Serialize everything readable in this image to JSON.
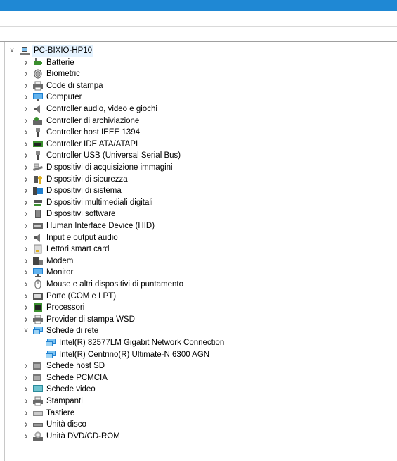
{
  "tree": {
    "root": {
      "label": "PC-BIXIO-HP10",
      "icon": "computer-icon"
    },
    "categories": [
      {
        "label": "Batterie",
        "icon": "battery-icon"
      },
      {
        "label": "Biometric",
        "icon": "fingerprint-icon"
      },
      {
        "label": "Code di stampa",
        "icon": "print-queue-icon"
      },
      {
        "label": "Computer",
        "icon": "monitor-icon"
      },
      {
        "label": "Controller audio, video e giochi",
        "icon": "speaker-icon"
      },
      {
        "label": "Controller di archiviazione",
        "icon": "storage-controller-icon"
      },
      {
        "label": "Controller host IEEE 1394",
        "icon": "firewire-icon"
      },
      {
        "label": "Controller IDE ATA/ATAPI",
        "icon": "ide-controller-icon"
      },
      {
        "label": "Controller USB (Universal Serial Bus)",
        "icon": "usb-icon"
      },
      {
        "label": "Dispositivi di acquisizione immagini",
        "icon": "scanner-icon"
      },
      {
        "label": "Dispositivi di sicurezza",
        "icon": "security-key-icon"
      },
      {
        "label": "Dispositivi di sistema",
        "icon": "system-device-icon"
      },
      {
        "label": "Dispositivi multimediali digitali",
        "icon": "media-device-icon"
      },
      {
        "label": "Dispositivi software",
        "icon": "software-device-icon"
      },
      {
        "label": "Human Interface Device (HID)",
        "icon": "hid-icon"
      },
      {
        "label": "Input e output audio",
        "icon": "speaker-icon"
      },
      {
        "label": "Lettori smart card",
        "icon": "smart-card-icon"
      },
      {
        "label": "Modem",
        "icon": "modem-icon"
      },
      {
        "label": "Monitor",
        "icon": "monitor-icon"
      },
      {
        "label": "Mouse e altri dispositivi di puntamento",
        "icon": "mouse-icon"
      },
      {
        "label": "Porte (COM e LPT)",
        "icon": "port-icon"
      },
      {
        "label": "Processori",
        "icon": "processor-icon"
      },
      {
        "label": "Provider di stampa WSD",
        "icon": "printer-icon"
      },
      {
        "label": "Schede di rete",
        "icon": "network-adapter-icon",
        "expanded": true,
        "children": [
          {
            "label": "Intel(R) 82577LM Gigabit Network Connection",
            "icon": "network-adapter-icon"
          },
          {
            "label": "Intel(R) Centrino(R) Ultimate-N 6300 AGN",
            "icon": "network-adapter-icon"
          }
        ]
      },
      {
        "label": "Schede host SD",
        "icon": "sd-host-icon"
      },
      {
        "label": "Schede PCMCIA",
        "icon": "pcmcia-icon"
      },
      {
        "label": "Schede video",
        "icon": "display-adapter-icon"
      },
      {
        "label": "Stampanti",
        "icon": "printer-icon"
      },
      {
        "label": "Tastiere",
        "icon": "keyboard-icon"
      },
      {
        "label": "Unità disco",
        "icon": "disk-drive-icon"
      },
      {
        "label": "Unità DVD/CD-ROM",
        "icon": "dvd-drive-icon"
      }
    ]
  },
  "colors": {
    "titlebar": "#1f88d4",
    "selection": "#e5f3ff",
    "icon_blue": "#1e7fd0"
  }
}
